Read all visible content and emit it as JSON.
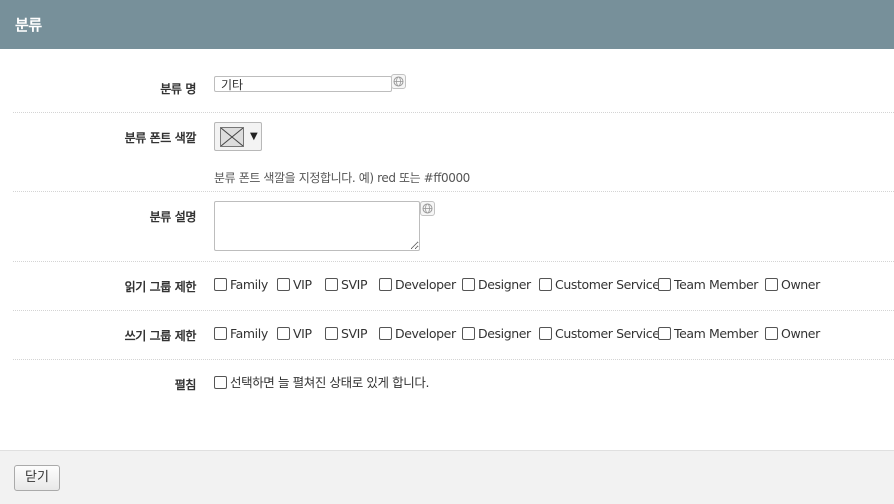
{
  "window": {
    "title": "분류"
  },
  "form": {
    "name": {
      "label": "분류 명",
      "value": "기타"
    },
    "font_color": {
      "label": "분류 폰트 색깔",
      "hint": "분류 폰트 색깔을 지정합니다. 예) red 또는 #ff0000"
    },
    "description": {
      "label": "분류 설명",
      "value": ""
    },
    "read_groups": {
      "label": "읽기 그룹 제한",
      "options": [
        "Family",
        "VIP",
        "SVIP",
        "Developer",
        "Designer",
        "Customer Service",
        "Team Member",
        "Owner"
      ]
    },
    "write_groups": {
      "label": "쓰기 그룹 제한",
      "options": [
        "Family",
        "VIP",
        "SVIP",
        "Developer",
        "Designer",
        "Customer Service",
        "Team Member",
        "Owner"
      ]
    },
    "expand": {
      "label": "펼침",
      "option": "선택하면 늘 펼쳐진 상태로 있게 합니다."
    }
  },
  "footer": {
    "close_label": "닫기"
  },
  "icons": {
    "translate": "globe-icon",
    "color": "no-color-swatch-icon",
    "dropdown": "caret-down-icon"
  }
}
